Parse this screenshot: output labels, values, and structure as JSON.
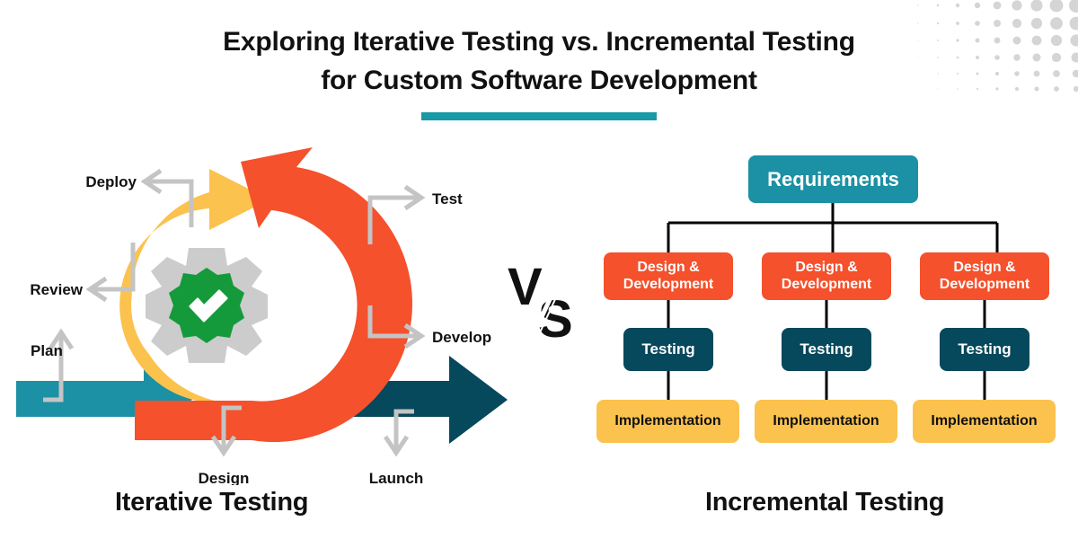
{
  "colors": {
    "teal": "#1C90A4",
    "teal_accent": "#1799A6",
    "orange": "#F4512C",
    "amber": "#FBC24E",
    "navy": "#06485C",
    "green": "#149A3B",
    "grey": "#CCCCCC",
    "arrow_grey": "#C4C4C4",
    "text_dark": "#111111",
    "text_light": "#FFFFFF",
    "dots": "#D5D5D5"
  },
  "header": {
    "title": "Exploring Iterative Testing vs. Incremental Testing for Custom Software Development",
    "underline_color": "#1799A6"
  },
  "comparison": {
    "separator_label": "VS"
  },
  "iterative": {
    "caption": "Iterative Testing",
    "center_icon": "gear-check-icon",
    "stages": [
      {
        "label": "Plan",
        "arrow": "up"
      },
      {
        "label": "Review",
        "arrow": "left"
      },
      {
        "label": "Deploy",
        "arrow": "left"
      },
      {
        "label": "Test",
        "arrow": "right"
      },
      {
        "label": "Develop",
        "arrow": "right"
      },
      {
        "label": "Design",
        "arrow": "down"
      },
      {
        "label": "Launch",
        "arrow": "down"
      }
    ]
  },
  "incremental": {
    "caption": "Incremental Testing",
    "root": {
      "label": "Requirements",
      "color": "#1C90A4"
    },
    "columns": [
      {
        "nodes": [
          {
            "label": "Design & Development",
            "color": "#F4512C",
            "text_color": "#FFFFFF"
          },
          {
            "label": "Testing",
            "color": "#06485C",
            "text_color": "#FFFFFF"
          },
          {
            "label": "Implementation",
            "color": "#FBC24E",
            "text_color": "#111111"
          }
        ]
      },
      {
        "nodes": [
          {
            "label": "Design & Development",
            "color": "#F4512C",
            "text_color": "#FFFFFF"
          },
          {
            "label": "Testing",
            "color": "#06485C",
            "text_color": "#FFFFFF"
          },
          {
            "label": "Implementation",
            "color": "#FBC24E",
            "text_color": "#111111"
          }
        ]
      },
      {
        "nodes": [
          {
            "label": "Design & Development",
            "color": "#F4512C",
            "text_color": "#FFFFFF"
          },
          {
            "label": "Testing",
            "color": "#06485C",
            "text_color": "#FFFFFF"
          },
          {
            "label": "Implementation",
            "color": "#FBC24E",
            "text_color": "#111111"
          }
        ]
      }
    ]
  }
}
